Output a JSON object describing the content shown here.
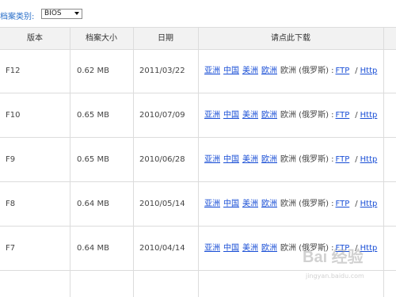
{
  "filter": {
    "label": "档案类别:",
    "selected": "BIOS"
  },
  "table": {
    "headers": [
      "版本",
      "档案大小",
      "日期",
      "请点此下载"
    ],
    "rows": [
      {
        "version": "F12",
        "size": "0.62 MB",
        "date": "2011/03/22"
      },
      {
        "version": "F10",
        "size": "0.65 MB",
        "date": "2010/07/09"
      },
      {
        "version": "F9",
        "size": "0.65 MB",
        "date": "2010/06/28"
      },
      {
        "version": "F8",
        "size": "0.64 MB",
        "date": "2010/05/14"
      },
      {
        "version": "F7",
        "size": "0.64 MB",
        "date": "2010/04/14"
      }
    ],
    "links": {
      "asia": "亚洲",
      "china": "中国",
      "america": "美洲",
      "europe": "欧洲",
      "europe_russia": "欧洲 (俄罗斯) :",
      "ftp": "FTP",
      "separator": "/",
      "http": "Http"
    }
  },
  "watermark": {
    "text": "Bai 经验",
    "sub": "jingyan.baidu.com"
  }
}
